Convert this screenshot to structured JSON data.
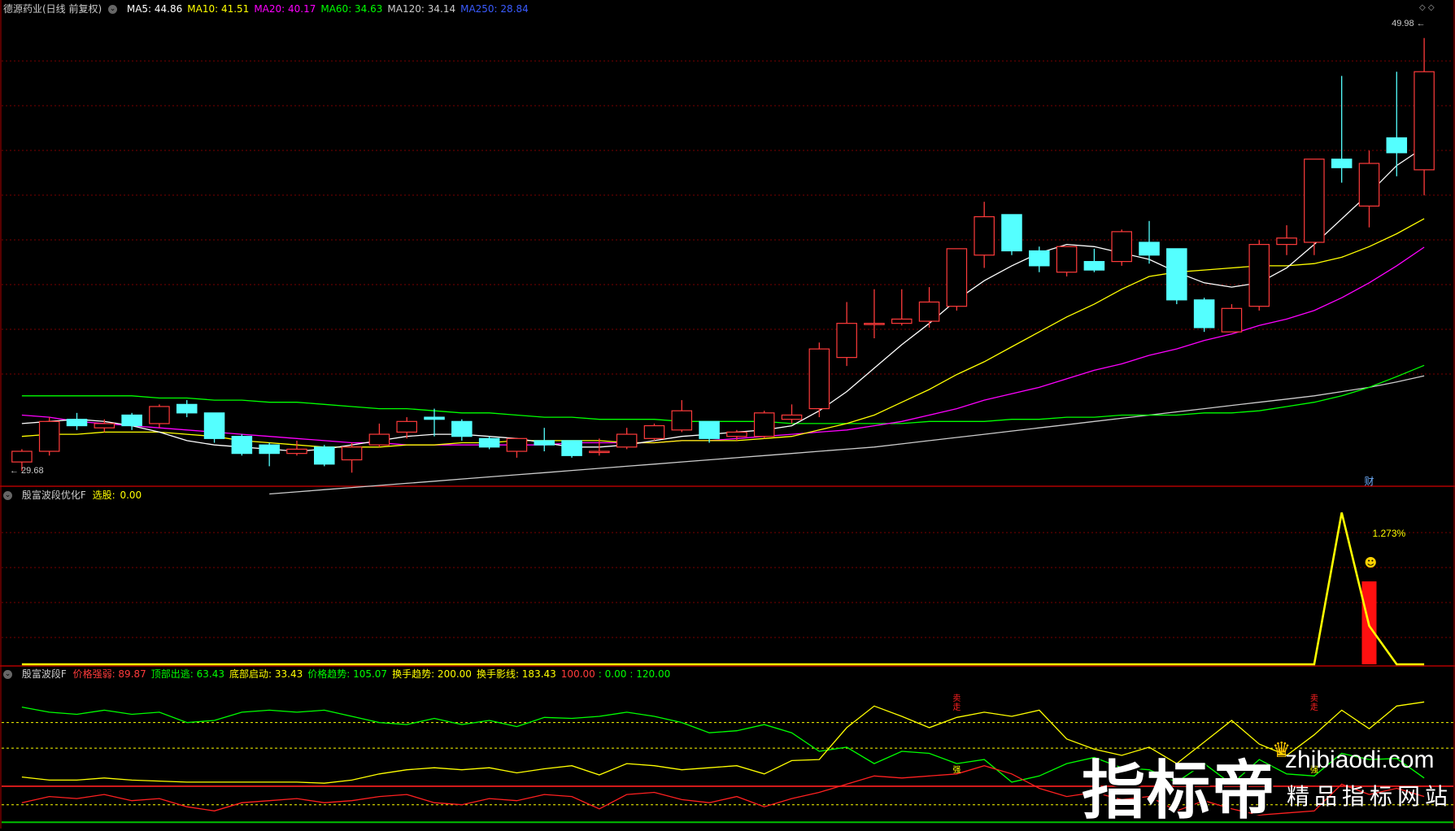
{
  "colors": {
    "up": "#ff3b3b",
    "down": "#54ffff",
    "ma5": "#ffffff",
    "ma10": "#ffff00",
    "ma20": "#ff00ff",
    "ma60": "#00ff00",
    "ma120": "#cccccc",
    "ma250": "#3a5bff",
    "grid": "#7a0000",
    "frame": "#b00000"
  },
  "main": {
    "stock_title": "德源药业(日线 前复权)",
    "legend": [
      {
        "label": "MA5:",
        "value": "44.86",
        "color": "#ffffff"
      },
      {
        "label": "MA10:",
        "value": "41.51",
        "color": "#ffff00"
      },
      {
        "label": "MA20:",
        "value": "40.17",
        "color": "#ff00ff"
      },
      {
        "label": "MA60:",
        "value": "34.63",
        "color": "#00ff00"
      },
      {
        "label": "MA120:",
        "value": "34.14",
        "color": "#cccccc"
      },
      {
        "label": "MA250:",
        "value": "28.84",
        "color": "#3a5bff"
      }
    ],
    "high_label": "49.98",
    "low_label": "29.68",
    "cai_label": "财",
    "diamond_icons": "◇ ◇",
    "chart_data": {
      "type": "candlestick",
      "y_range": [
        29.0,
        51.0
      ],
      "candles": [
        [
          30.1,
          30.6,
          29.68,
          30.7
        ],
        [
          30.6,
          32.0,
          30.4,
          32.2
        ],
        [
          32.1,
          31.8,
          31.6,
          32.4
        ],
        [
          31.7,
          31.9,
          31.5,
          32.1
        ],
        [
          32.3,
          31.8,
          31.6,
          32.4
        ],
        [
          31.9,
          32.7,
          31.7,
          32.8
        ],
        [
          32.8,
          32.4,
          32.2,
          33.0
        ],
        [
          32.4,
          31.2,
          31.0,
          32.4
        ],
        [
          31.3,
          30.5,
          30.4,
          31.4
        ],
        [
          30.9,
          30.5,
          29.9,
          31.0
        ],
        [
          30.5,
          30.7,
          30.4,
          31.1
        ],
        [
          30.8,
          30.0,
          29.9,
          30.9
        ],
        [
          30.2,
          30.8,
          29.6,
          31.0
        ],
        [
          30.9,
          31.4,
          30.8,
          31.9
        ],
        [
          31.5,
          32.0,
          31.2,
          32.2
        ],
        [
          32.2,
          32.1,
          31.3,
          32.6
        ],
        [
          32.0,
          31.3,
          31.1,
          32.1
        ],
        [
          31.2,
          30.8,
          30.7,
          31.3
        ],
        [
          30.6,
          31.2,
          30.3,
          31.2
        ],
        [
          31.1,
          30.9,
          30.6,
          31.7
        ],
        [
          31.1,
          30.4,
          30.3,
          31.1
        ],
        [
          30.6,
          30.6,
          30.4,
          31.2
        ],
        [
          30.8,
          31.4,
          30.7,
          31.7
        ],
        [
          31.2,
          31.8,
          31.1,
          31.9
        ],
        [
          31.6,
          32.5,
          31.5,
          33.0
        ],
        [
          32.0,
          31.2,
          31.0,
          32.0
        ],
        [
          31.3,
          31.5,
          31.1,
          31.6
        ],
        [
          31.3,
          32.4,
          31.2,
          32.5
        ],
        [
          32.1,
          32.3,
          31.9,
          32.8
        ],
        [
          32.6,
          35.4,
          32.2,
          35.7
        ],
        [
          35.0,
          36.6,
          34.6,
          37.6
        ],
        [
          36.6,
          36.6,
          35.9,
          38.2
        ],
        [
          36.6,
          36.8,
          36.5,
          38.2
        ],
        [
          36.7,
          37.6,
          36.4,
          38.3
        ],
        [
          37.4,
          40.1,
          37.2,
          40.1
        ],
        [
          39.8,
          41.6,
          39.2,
          42.3
        ],
        [
          41.7,
          40.0,
          39.8,
          41.7
        ],
        [
          40.0,
          39.3,
          39.0,
          40.2
        ],
        [
          39.0,
          40.2,
          38.8,
          40.2
        ],
        [
          39.5,
          39.1,
          39.0,
          40.1
        ],
        [
          39.5,
          40.9,
          39.3,
          41.0
        ],
        [
          40.4,
          39.8,
          39.4,
          41.4
        ],
        [
          40.1,
          37.7,
          37.5,
          40.1
        ],
        [
          37.7,
          36.4,
          36.2,
          37.8
        ],
        [
          36.2,
          37.3,
          36.2,
          37.5
        ],
        [
          37.4,
          40.3,
          37.2,
          40.5
        ],
        [
          40.3,
          40.6,
          39.8,
          41.2
        ],
        [
          40.4,
          44.3,
          39.8,
          44.3
        ],
        [
          44.3,
          43.9,
          43.2,
          48.2
        ],
        [
          42.1,
          44.1,
          41.1,
          44.7
        ],
        [
          45.3,
          44.6,
          43.5,
          48.4
        ],
        [
          43.8,
          48.4,
          42.6,
          49.98
        ]
      ],
      "ma5": [
        31.9,
        32.0,
        32.1,
        32.0,
        31.8,
        31.5,
        31.1,
        30.9,
        30.8,
        30.7,
        30.6,
        30.7,
        30.9,
        31.1,
        31.3,
        31.4,
        31.4,
        31.3,
        31.2,
        31.0,
        30.8,
        30.8,
        30.9,
        31.1,
        31.3,
        31.4,
        31.5,
        31.6,
        31.8,
        32.5,
        33.4,
        34.5,
        35.6,
        36.6,
        37.7,
        38.6,
        39.3,
        39.9,
        40.3,
        40.2,
        39.9,
        39.6,
        39.0,
        38.5,
        38.3,
        38.5,
        39.2,
        40.3,
        41.5,
        42.7,
        44.0,
        44.86
      ],
      "ma10": [
        31.3,
        31.4,
        31.4,
        31.5,
        31.5,
        31.5,
        31.4,
        31.3,
        31.1,
        31.0,
        30.9,
        30.8,
        30.8,
        30.8,
        30.9,
        30.9,
        31.0,
        31.0,
        31.1,
        31.1,
        31.1,
        31.1,
        31.0,
        31.0,
        31.1,
        31.1,
        31.1,
        31.2,
        31.3,
        31.6,
        31.9,
        32.3,
        32.9,
        33.5,
        34.2,
        34.8,
        35.5,
        36.2,
        36.9,
        37.5,
        38.2,
        38.8,
        39.0,
        39.1,
        39.2,
        39.3,
        39.3,
        39.4,
        39.7,
        40.2,
        40.8,
        41.51
      ],
      "ma20": [
        32.3,
        32.2,
        32.0,
        31.9,
        31.8,
        31.7,
        31.6,
        31.5,
        31.4,
        31.3,
        31.2,
        31.1,
        31.0,
        31.0,
        30.9,
        30.9,
        30.9,
        30.9,
        30.9,
        30.9,
        31.0,
        31.0,
        31.0,
        31.0,
        31.1,
        31.1,
        31.2,
        31.3,
        31.4,
        31.5,
        31.6,
        31.8,
        32.0,
        32.3,
        32.6,
        33.0,
        33.3,
        33.6,
        34.0,
        34.4,
        34.7,
        35.1,
        35.4,
        35.8,
        36.1,
        36.5,
        36.8,
        37.2,
        37.8,
        38.5,
        39.3,
        40.17
      ],
      "ma60": [
        33.2,
        33.2,
        33.2,
        33.2,
        33.2,
        33.1,
        33.1,
        33.0,
        33.0,
        32.9,
        32.9,
        32.8,
        32.7,
        32.6,
        32.6,
        32.5,
        32.4,
        32.4,
        32.3,
        32.2,
        32.2,
        32.1,
        32.1,
        32.1,
        32.0,
        32.0,
        32.0,
        32.0,
        31.9,
        31.9,
        31.9,
        31.9,
        31.9,
        32.0,
        32.0,
        32.0,
        32.1,
        32.1,
        32.2,
        32.2,
        32.3,
        32.3,
        32.3,
        32.4,
        32.4,
        32.5,
        32.7,
        32.9,
        33.2,
        33.6,
        34.1,
        34.63
      ],
      "ma120": [
        null,
        null,
        null,
        null,
        null,
        null,
        null,
        null,
        null,
        28.6,
        28.7,
        28.8,
        28.9,
        29.0,
        29.1,
        29.2,
        29.3,
        29.4,
        29.5,
        29.6,
        29.7,
        29.8,
        29.9,
        30.0,
        30.1,
        30.2,
        30.3,
        30.4,
        30.5,
        30.6,
        30.7,
        30.8,
        30.95,
        31.1,
        31.25,
        31.4,
        31.55,
        31.7,
        31.85,
        32.0,
        32.15,
        32.3,
        32.45,
        32.6,
        32.75,
        32.9,
        33.05,
        33.2,
        33.4,
        33.6,
        33.85,
        34.14
      ]
    }
  },
  "pane2": {
    "title": "殷富波段优化F",
    "label": "选股:",
    "value": "0.00",
    "pct_label": "1.273%",
    "smile_icon": "☻",
    "chart_data": {
      "type": "line",
      "y_range": [
        0,
        1.6
      ],
      "yellow_line": [
        0,
        0,
        0,
        0,
        0,
        0,
        0,
        0,
        0,
        0,
        0,
        0,
        0,
        0,
        0,
        0,
        0,
        0,
        0,
        0,
        0,
        0,
        0,
        0,
        0,
        0,
        0,
        0,
        0,
        0,
        0,
        0,
        0,
        0,
        0,
        0,
        0,
        0,
        0,
        0,
        0,
        0,
        0,
        0,
        0,
        0,
        0,
        0,
        1.5,
        0.38,
        0,
        0
      ],
      "red_bar": {
        "index": 49,
        "value": 0.82
      }
    }
  },
  "pane3": {
    "title": "殷富波段F",
    "legend": [
      {
        "label": "价格强弱:",
        "value": "89.87",
        "color": "#ff3b3b"
      },
      {
        "label": "顶部出逃:",
        "value": "63.43",
        "color": "#00ff00"
      },
      {
        "label": "底部启动:",
        "value": "33.43",
        "color": "#ffff00"
      },
      {
        "label": "价格趋势:",
        "value": "105.07",
        "color": "#00ff00"
      },
      {
        "label": "换手趋势:",
        "value": "200.00",
        "color": "#ffff00"
      },
      {
        "label": "换手影线:",
        "value": "183.43",
        "color": "#ffff00"
      }
    ],
    "levels": [
      {
        "text": "100.00",
        "color": "#ff3b3b"
      },
      {
        "text": ": 0.00",
        "color": "#00ff00"
      },
      {
        "text": ": 120.00",
        "color": "#00ff00"
      }
    ],
    "mark_top": "卖\n走",
    "mark_strong": "强",
    "chart_data": {
      "type": "line",
      "y_range": [
        0,
        140
      ],
      "yellow": [
        47,
        44,
        44,
        46,
        44,
        43,
        42,
        42,
        42,
        42,
        42,
        41,
        44,
        50,
        54,
        56,
        54,
        56,
        51,
        55,
        58,
        49,
        60,
        58,
        54,
        56,
        58,
        50,
        63,
        64,
        95,
        116,
        106,
        95,
        105,
        110,
        106,
        112,
        84,
        74,
        68,
        76,
        60,
        81,
        102,
        79,
        68,
        88,
        112,
        94,
        116,
        120
      ],
      "green": [
        115,
        110,
        108,
        112,
        108,
        110,
        100,
        102,
        110,
        112,
        110,
        112,
        106,
        100,
        98,
        104,
        98,
        102,
        96,
        105,
        104,
        106,
        110,
        106,
        100,
        90,
        92,
        98,
        90,
        72,
        76,
        60,
        72,
        70,
        60,
        64,
        42,
        48,
        60,
        66,
        56,
        54,
        42,
        60,
        40,
        64,
        50,
        48,
        70,
        64,
        65,
        46
      ],
      "red": [
        22,
        28,
        26,
        30,
        24,
        26,
        18,
        14,
        22,
        24,
        26,
        22,
        24,
        28,
        30,
        22,
        20,
        26,
        24,
        30,
        28,
        16,
        30,
        32,
        25,
        22,
        28,
        18,
        26,
        32,
        40,
        48,
        46,
        48,
        50,
        58,
        50,
        36,
        28,
        32,
        25,
        28,
        14,
        24,
        16,
        10,
        12,
        14,
        40,
        30,
        36,
        28
      ]
    }
  },
  "watermark": {
    "title": "指标帝",
    "domain": "zhibiaodi.com",
    "subtitle": "精品指标网站"
  }
}
